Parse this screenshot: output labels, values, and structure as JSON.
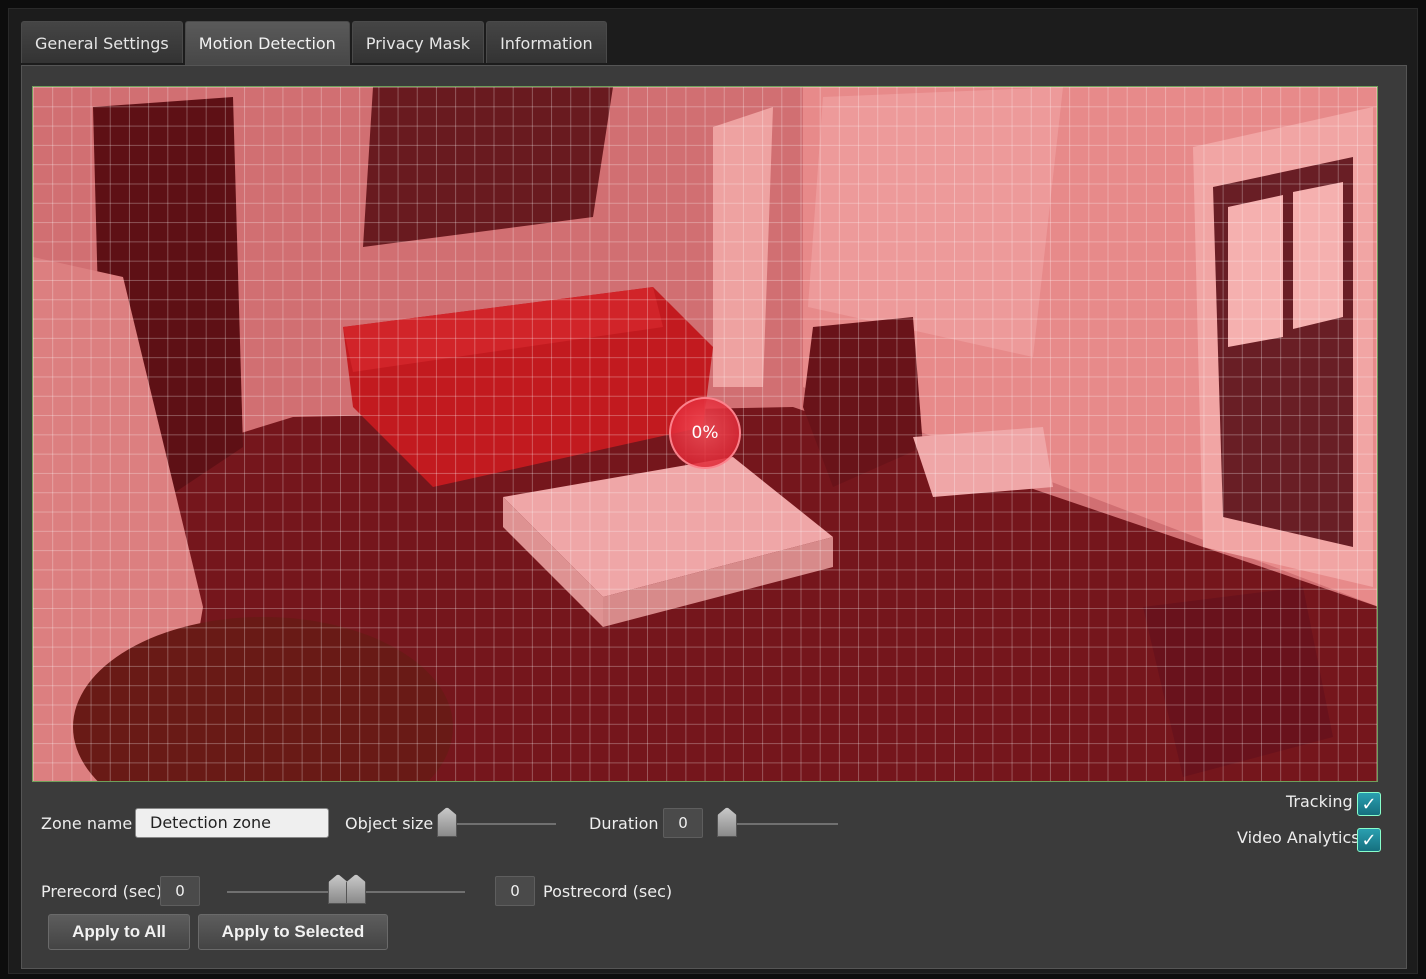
{
  "tabs": [
    {
      "label": "General Settings"
    },
    {
      "label": "Motion Detection"
    },
    {
      "label": "Privacy Mask"
    },
    {
      "label": "Information"
    }
  ],
  "active_tab": "Motion Detection",
  "video": {
    "motion_level": "0%",
    "overlay_color": "#e61e28",
    "grid_color": "#ffffff",
    "zone_border_color": "#6f9f5a"
  },
  "controls": {
    "zone_name_label": "Zone name",
    "zone_name_value": "Detection zone",
    "object_size_label": "Object size",
    "object_size_level": 0,
    "duration_label": "Duration",
    "duration_value": "0",
    "duration_level": 0,
    "prerecord_label": "Prerecord (sec)",
    "prerecord_value": "0",
    "postrecord_label": "Postrecord (sec)",
    "postrecord_value": "0",
    "tracking_label": "Tracking",
    "tracking_checked": true,
    "video_analytics_label": "Video Analytics",
    "video_analytics_checked": true,
    "checkmark": "✓"
  },
  "buttons": {
    "apply_all": "Apply to All",
    "apply_selected": "Apply to Selected"
  }
}
